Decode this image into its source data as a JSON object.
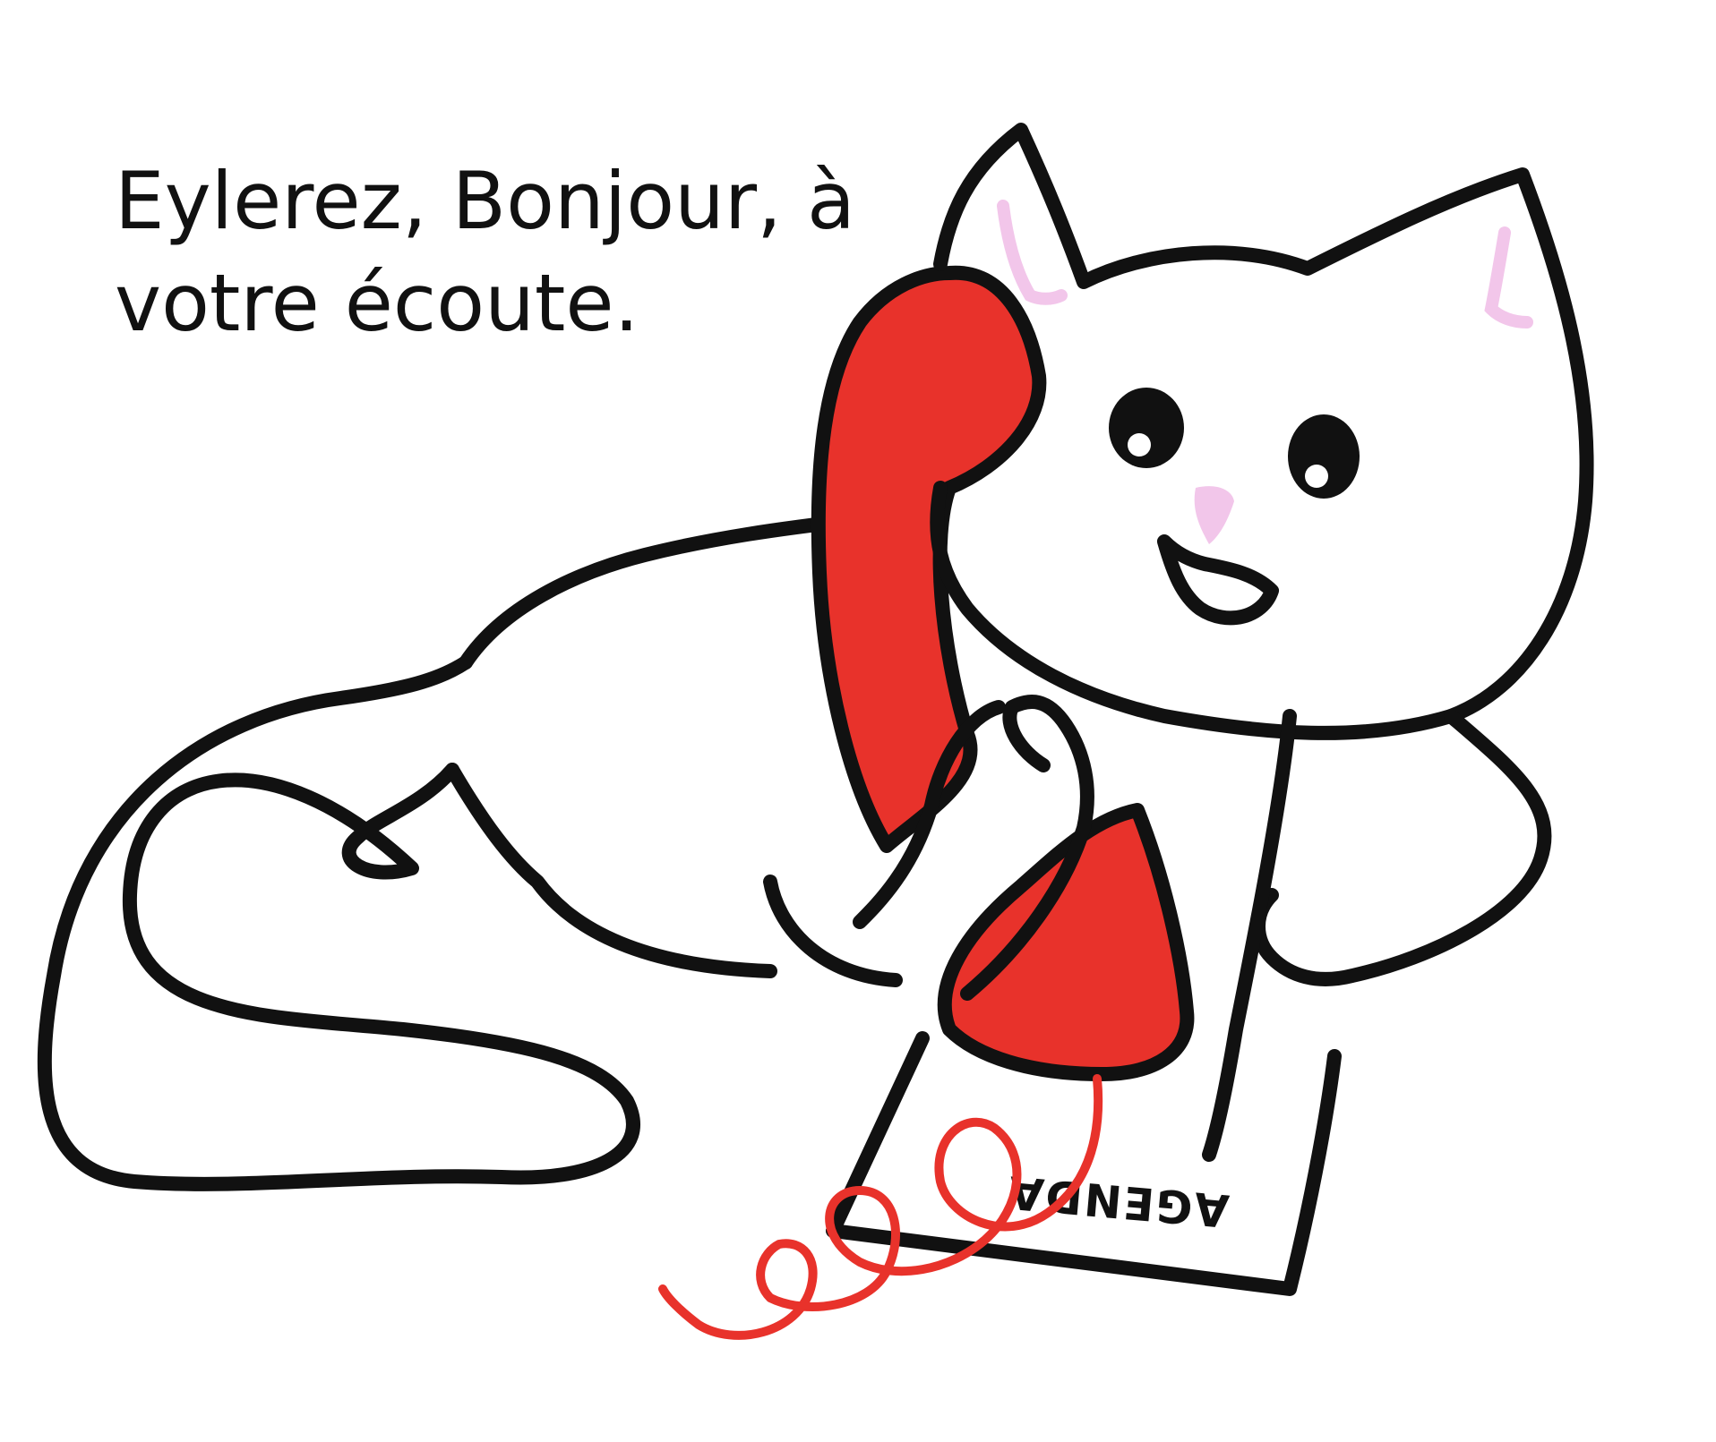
{
  "caption": {
    "line1": "Eylerez, Bonjour, à",
    "line2": "votre écoute."
  },
  "notebook": {
    "label": "AGENDA"
  },
  "colors": {
    "background": "#ffffff",
    "ink": "#111111",
    "phone": "#e8322b",
    "ear_and_nose_pink": "#f2c6ea"
  },
  "illustration": {
    "subject_icon": "cat-icon",
    "props": [
      "telephone-icon",
      "pen-icon",
      "agenda-icon"
    ]
  }
}
